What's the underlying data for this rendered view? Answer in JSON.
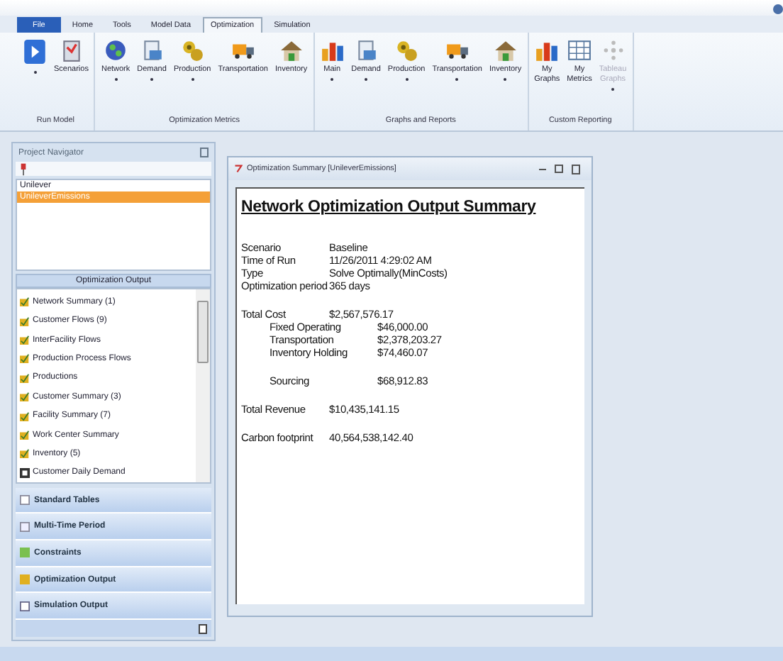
{
  "menu_tabs": [
    {
      "label": "File",
      "kind": "file",
      "selected": false
    },
    {
      "label": "Home",
      "kind": "tab",
      "selected": false
    },
    {
      "label": "Tools",
      "kind": "tab",
      "selected": false
    },
    {
      "label": "Model Data",
      "kind": "tab",
      "selected": false
    },
    {
      "label": "Optimization",
      "kind": "tab",
      "selected": true
    },
    {
      "label": "Simulation",
      "kind": "tab",
      "selected": false
    }
  ],
  "ribbon": [
    {
      "label": "Run Model",
      "items": [
        {
          "kind": "run",
          "dropdown": true,
          "disabled": false
        },
        {
          "kind": "scenarios",
          "label": "Scenarios",
          "dropdown": false,
          "disabled": false
        }
      ]
    },
    {
      "label": "Optimization Metrics",
      "items": [
        {
          "kind": "globe",
          "label": "Network",
          "dropdown": true,
          "disabled": false
        },
        {
          "kind": "document",
          "label": "Demand",
          "dropdown": true,
          "disabled": false
        },
        {
          "kind": "gears",
          "label": "Production",
          "dropdown": true,
          "disabled": false
        },
        {
          "kind": "truck",
          "label": "Transportation",
          "dropdown": false,
          "disabled": false
        },
        {
          "kind": "house",
          "label": "Inventory",
          "dropdown": false,
          "disabled": false
        }
      ]
    },
    {
      "label": "Graphs and Reports",
      "items": [
        {
          "kind": "chart",
          "label": "Main",
          "dropdown": true,
          "disabled": false
        },
        {
          "kind": "document",
          "label": "Demand",
          "dropdown": true,
          "disabled": false
        },
        {
          "kind": "gears",
          "label": "Production",
          "dropdown": true,
          "disabled": false
        },
        {
          "kind": "truck",
          "label": "Transportation",
          "dropdown": true,
          "disabled": false
        },
        {
          "kind": "house",
          "label": "Inventory",
          "dropdown": true,
          "disabled": false
        }
      ]
    },
    {
      "label": "Custom Reporting",
      "items": [
        {
          "kind": "chart",
          "label": "My Graphs",
          "dropdown": false,
          "disabled": false
        },
        {
          "kind": "grid",
          "label": "My Metrics",
          "dropdown": false,
          "disabled": false
        },
        {
          "kind": "dots",
          "label": "Tableau Graphs",
          "dropdown": true,
          "disabled": true
        }
      ]
    }
  ],
  "project_navigator": {
    "title": "Project Navigator",
    "projects": [
      {
        "label": "Unilever",
        "selected": false
      },
      {
        "label": "UnileverEmissions",
        "selected": true
      }
    ]
  },
  "output_list": {
    "title": "Optimization Output",
    "items": [
      {
        "label": "Network Summary (1)",
        "kind": "report"
      },
      {
        "label": "Customer Flows (9)",
        "kind": "report"
      },
      {
        "label": "InterFacility Flows",
        "kind": "report"
      },
      {
        "label": "Production Process Flows",
        "kind": "report"
      },
      {
        "label": "Productions",
        "kind": "report"
      },
      {
        "label": "Customer Summary (3)",
        "kind": "report"
      },
      {
        "label": "Facility Summary (7)",
        "kind": "report"
      },
      {
        "label": "Work Center Summary",
        "kind": "report"
      },
      {
        "label": "Inventory (5)",
        "kind": "report"
      },
      {
        "label": "Customer Daily Demand",
        "kind": "daily"
      }
    ]
  },
  "accordion": [
    {
      "label": "Standard Tables",
      "kind": "table"
    },
    {
      "label": "Multi-Time Period",
      "kind": "multi"
    },
    {
      "label": "Constraints",
      "kind": "constraint"
    },
    {
      "label": "Optimization Output",
      "kind": "report"
    },
    {
      "label": "Simulation Output",
      "kind": "sim"
    }
  ],
  "summary_window": {
    "title": "Optimization Summary [UnileverEmissions]",
    "heading": "Network Optimization Output Summary",
    "sections": [
      {
        "rows": [
          {
            "kind": "main",
            "label": "Scenario",
            "value": "Baseline"
          },
          {
            "kind": "main",
            "label": "Time of Run",
            "value": "11/26/2011 4:29:02 AM"
          },
          {
            "kind": "main",
            "label": "Type",
            "value": "Solve Optimally(MinCosts)"
          },
          {
            "kind": "main",
            "label": "Optimization period",
            "value": "365 days"
          }
        ]
      },
      {
        "rows": [
          {
            "kind": "main",
            "label": "Total Cost",
            "value": "$2,567,576.17"
          },
          {
            "kind": "detail",
            "label": "Fixed Operating",
            "value": "$46,000.00"
          },
          {
            "kind": "detail",
            "label": "Transportation",
            "value": "$2,378,203.27"
          },
          {
            "kind": "detail",
            "label": "Inventory Holding",
            "value": "$74,460.07"
          }
        ]
      },
      {
        "rows": [
          {
            "kind": "detail",
            "label": "Sourcing",
            "value": "$68,912.83"
          }
        ]
      },
      {
        "rows": [
          {
            "kind": "main",
            "label": "Total Revenue",
            "value": "$10,435,141.15"
          }
        ]
      },
      {
        "rows": [
          {
            "kind": "main",
            "label": "Carbon footprint",
            "value": "40,564,538,142.40"
          }
        ]
      }
    ]
  }
}
